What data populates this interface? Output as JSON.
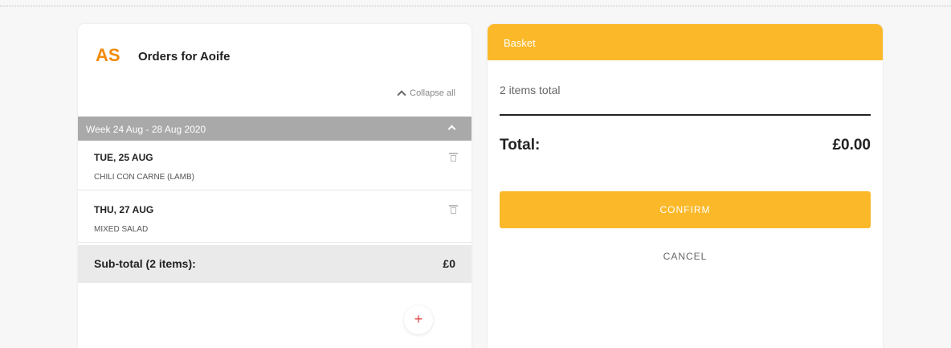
{
  "orders": {
    "initials": "AS",
    "title": "Orders for Aoife",
    "collapse_all_label": "Collapse all",
    "week_label": "Week 24 Aug - 28 Aug 2020",
    "items": [
      {
        "date": "TUE, 25 AUG",
        "item": "CHILI CON CARNE (LAMB)"
      },
      {
        "date": "THU, 27 AUG",
        "item": "MIXED SALAD"
      }
    ],
    "subtotal_label": "Sub-total (2 items):",
    "subtotal_value": "£0",
    "add_label": "+"
  },
  "basket": {
    "title": "Basket",
    "items_total": "2 items total",
    "total_label": "Total:",
    "total_value": "£0.00",
    "confirm_label": "CONFIRM",
    "cancel_label": "CANCEL"
  },
  "colors": {
    "accent": "#fbb829",
    "initials": "#f28a0a",
    "add_icon": "#e04848"
  },
  "icons": {
    "collapse": "chevron-up-icon",
    "week": "chevron-up-icon",
    "delete": "trash-icon",
    "add": "plus-icon"
  }
}
